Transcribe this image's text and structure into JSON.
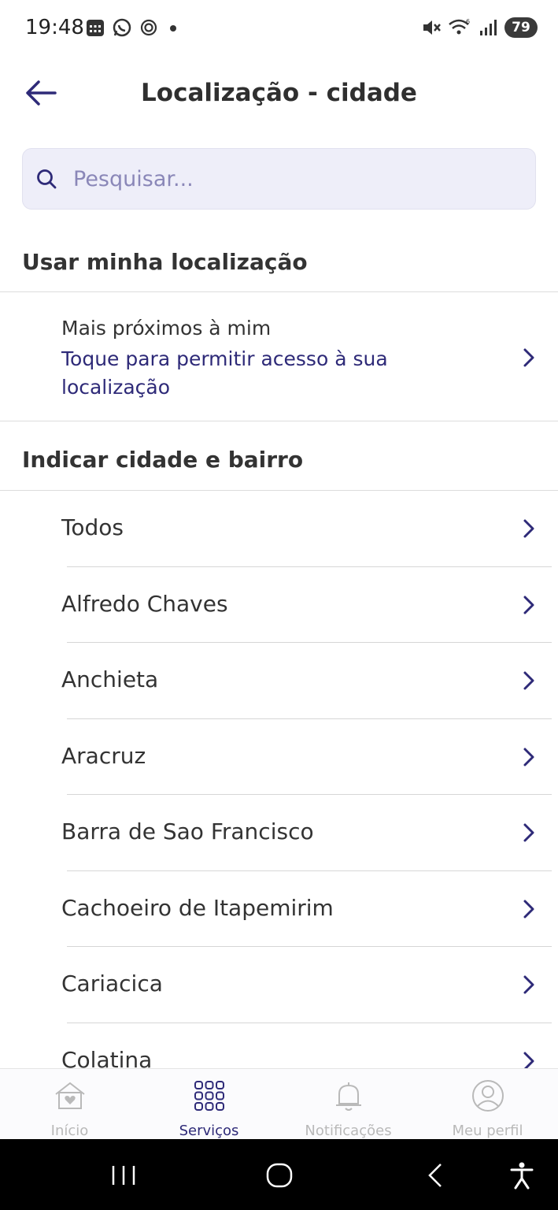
{
  "status_bar": {
    "time": "19:48",
    "battery": "79",
    "left_icons": [
      "calendar-icon",
      "whatsapp-icon",
      "openai-icon",
      "dot-icon"
    ],
    "right_icons": [
      "mute-icon",
      "wifi-icon",
      "signal-icon",
      "battery-icon"
    ]
  },
  "header": {
    "title": "Localização - cidade"
  },
  "search": {
    "placeholder": "Pesquisar...",
    "value": ""
  },
  "section_location": {
    "title": "Usar minha localização",
    "item_title": "Mais próximos à mim",
    "item_subtitle": "Toque para permitir acesso à sua localização"
  },
  "section_city": {
    "title": "Indicar cidade e bairro",
    "cities": [
      "Todos",
      "Alfredo Chaves",
      "Anchieta",
      "Aracruz",
      "Barra de Sao Francisco",
      "Cachoeiro de Itapemirim",
      "Cariacica",
      "Colatina"
    ]
  },
  "bottom_nav": {
    "items": [
      {
        "label": "Início",
        "icon": "home-heart-icon",
        "active": false
      },
      {
        "label": "Serviços",
        "icon": "grid-icon",
        "active": true
      },
      {
        "label": "Notificações",
        "icon": "bell-icon",
        "active": false
      },
      {
        "label": "Meu perfil",
        "icon": "user-icon",
        "active": false
      }
    ]
  },
  "colors": {
    "accent": "#2e2a78",
    "search_bg": "#eeeef9",
    "inactive": "#b9b9b9"
  }
}
